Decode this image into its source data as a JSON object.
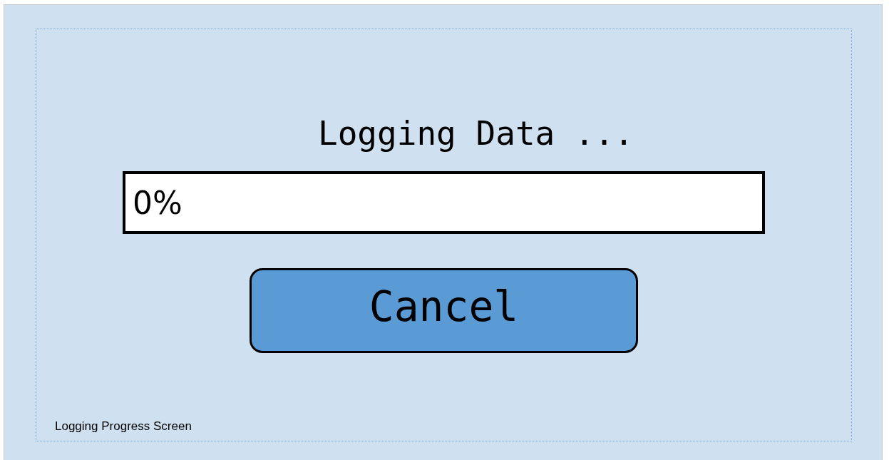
{
  "title": "Logging Data ...",
  "progress": {
    "level": 0,
    "reading": "0%"
  },
  "buttons": [
    {
      "label": "Cancel",
      "kind": "primary"
    }
  ],
  "caption": "Logging Progress Screen"
}
